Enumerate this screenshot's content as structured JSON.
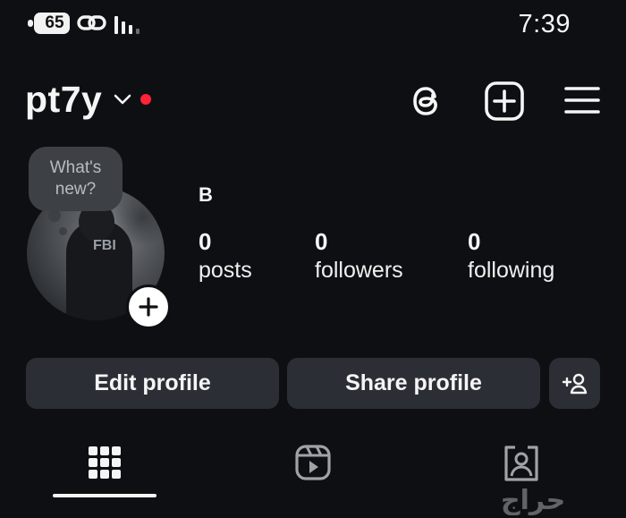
{
  "status_bar": {
    "battery": "65",
    "time": "7:39"
  },
  "header": {
    "username": "pt7y",
    "icons": [
      "threads-icon",
      "create-icon",
      "menu-icon"
    ],
    "notification_color": "#ff2338"
  },
  "profile": {
    "note_bubble": "What's\nnew?",
    "display_name": "B",
    "stats": [
      {
        "value": "0",
        "label": "posts"
      },
      {
        "value": "0",
        "label": "followers"
      },
      {
        "value": "0",
        "label": "following"
      }
    ],
    "avatar_text": "FBI"
  },
  "actions": {
    "edit_label": "Edit profile",
    "share_label": "Share profile"
  },
  "tabs": {
    "items": [
      "grid-icon",
      "reels-icon",
      "tagged-icon"
    ],
    "active": "grid-icon"
  },
  "watermark": "حراج"
}
